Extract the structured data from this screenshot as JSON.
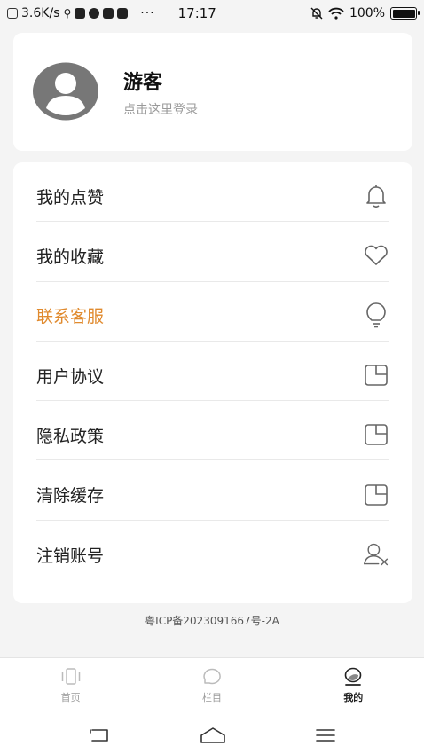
{
  "status_bar": {
    "net_speed": "3.6K/s",
    "time": "17:17",
    "battery": "100%",
    "battery_level": 1.0
  },
  "profile": {
    "name": "游客",
    "login_hint": "点击这里登录"
  },
  "menu": {
    "items": [
      {
        "label": "我的点赞",
        "icon": "bell-icon"
      },
      {
        "label": "我的收藏",
        "icon": "heart-icon"
      },
      {
        "label": "联系客服",
        "icon": "lightbulb-icon",
        "accent": "#e08a2e"
      },
      {
        "label": "用户协议",
        "icon": "document-icon"
      },
      {
        "label": "隐私政策",
        "icon": "document-icon"
      },
      {
        "label": "清除缓存",
        "icon": "document-icon"
      },
      {
        "label": "注销账号",
        "icon": "user-remove-icon"
      }
    ]
  },
  "footer": {
    "icp": "粤ICP备2023091667号-2A"
  },
  "tab_bar": {
    "tabs": [
      {
        "label": "首页",
        "icon": "home-icon",
        "active": false
      },
      {
        "label": "栏目",
        "icon": "chat-bubble-icon",
        "active": false
      },
      {
        "label": "我的",
        "icon": "profile-icon",
        "active": true
      }
    ]
  },
  "colors": {
    "accent": "#e08a2e",
    "background": "#f4f4f4",
    "card": "#ffffff"
  }
}
